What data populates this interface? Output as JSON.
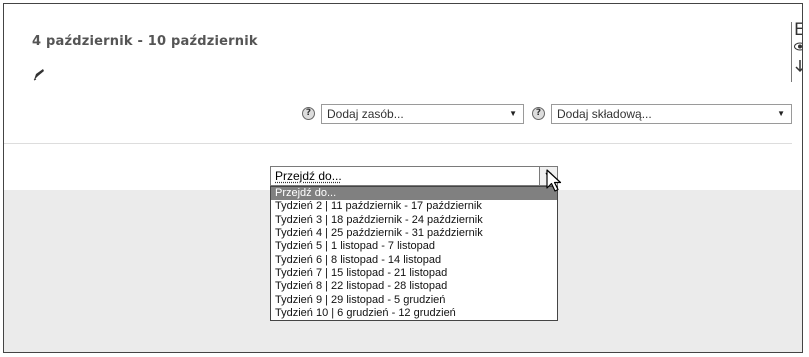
{
  "section": {
    "title": "4 październik - 10 październik"
  },
  "right_panel": {
    "edge_glyph": "E"
  },
  "toolbar": {
    "help_symbol": "?",
    "add_resource": {
      "value": "Dodaj zasób..."
    },
    "add_activity": {
      "value": "Dodaj składową..."
    }
  },
  "jump": {
    "value": "Przejdź do...",
    "options": [
      "Przejdź do...",
      "Tydzień 2 | 11 październik - 17 październik",
      "Tydzień 3 | 18 październik - 24 październik",
      "Tydzień 4 | 25 październik - 31 październik",
      "Tydzień 5 | 1 listopad - 7 listopad",
      "Tydzień 6 | 8 listopad - 14 listopad",
      "Tydzień 7 | 15 listopad - 21 listopad",
      "Tydzień 8 | 22 listopad - 28 listopad",
      "Tydzień 9 | 29 listopad - 5 grudzień",
      "Tydzień 10 | 6 grudzień - 12 grudzień"
    ],
    "highlighted_index": 0
  },
  "icons": {
    "edit": "edit-icon",
    "visibility": "eye-icon",
    "move": "arrow-down-icon",
    "help": "help-icon",
    "cursor": "cursor-icon"
  },
  "colors": {
    "title_text": "#555555",
    "highlight": "#808080",
    "gray_area": "#ebebeb"
  }
}
